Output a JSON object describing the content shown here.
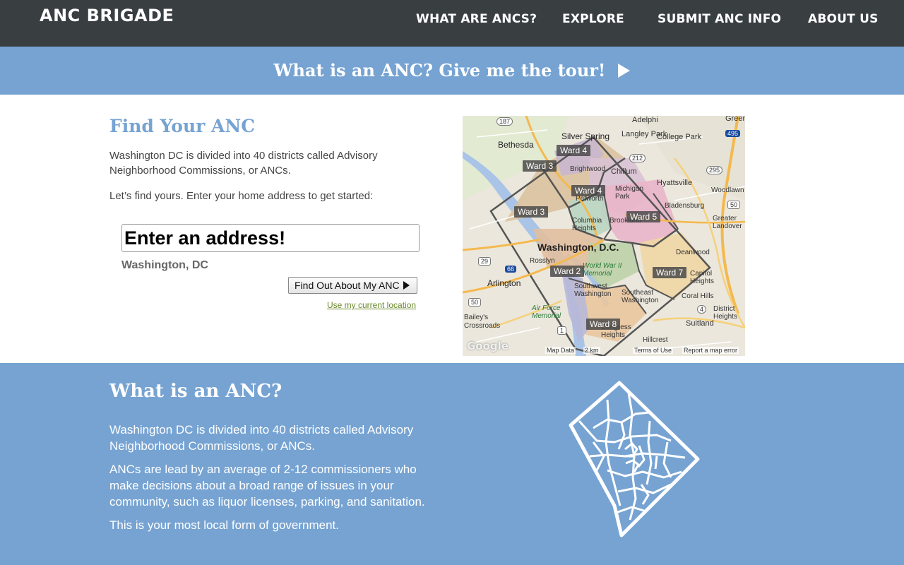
{
  "brand": "ANC BRIGADE",
  "nav": [
    {
      "label": "WHAT ARE ANCS?"
    },
    {
      "label": "EXPLORE"
    },
    {
      "label": "SUBMIT ANC INFO"
    },
    {
      "label": "ABOUT US"
    }
  ],
  "tour": {
    "label": "What is an ANC? Give me the tour!"
  },
  "find": {
    "title": "Find Your ANC",
    "intro": "Washington DC is divided into 40 districts called Advisory Neighborhood Commissions, or ANCs.",
    "prompt": "Let’s find yours. Enter your home address to get started:",
    "input_placeholder": "Enter an address!",
    "input_value": "",
    "city": "Washington, DC",
    "button_label": "Find Out About My ANC",
    "location_link": "Use my current location"
  },
  "map": {
    "wards": [
      "Ward 4",
      "Ward 3",
      "Ward 4",
      "Ward 3",
      "Ward 5",
      "Ward 2",
      "Ward 7",
      "Ward 8"
    ],
    "places": [
      "Silver Spring",
      "Bethesda",
      "Adelphi",
      "Langley Park",
      "College Park",
      "Chillum",
      "Brightwood",
      "Hyattsville",
      "Michigan Park",
      "Petworth",
      "Columbia Heights",
      "Brookland",
      "Bladensburg",
      "Washington, D.C.",
      "Rosslyn",
      "Arlington",
      "World War II Memorial",
      "Southwest Washington",
      "Southeast Washington",
      "Air Force Memorial",
      "Deanwood",
      "Capitol Heights",
      "Coral Hills",
      "District Heights",
      "Suitland",
      "Bailey's Crossroads",
      "Congress Heights",
      "Hillcrest",
      "Woodlawn",
      "Greater Landover",
      "Greenbelt"
    ],
    "highway_shields": [
      "187",
      "212",
      "495",
      "295",
      "50",
      "29",
      "66",
      "50",
      "4",
      "1"
    ],
    "footer": [
      "Map Data",
      "2 km",
      "Terms of Use",
      "Report a map error"
    ],
    "logo": "Google"
  },
  "what": {
    "title": "What is an ANC?",
    "paragraphs": [
      "Washington DC is divided into 40 districts called Advisory Neighborhood Commissions, or ANCs.",
      "ANCs are lead by an average of 2-12 commissioners who make decisions about a broad range of issues in your community, such as liquor licenses, parking, and sanitation.",
      "This is your most local form of government."
    ]
  },
  "colors": {
    "nav_bg": "#393e41",
    "accent_blue": "#76a3d2",
    "link_green": "#6a8a2a"
  }
}
